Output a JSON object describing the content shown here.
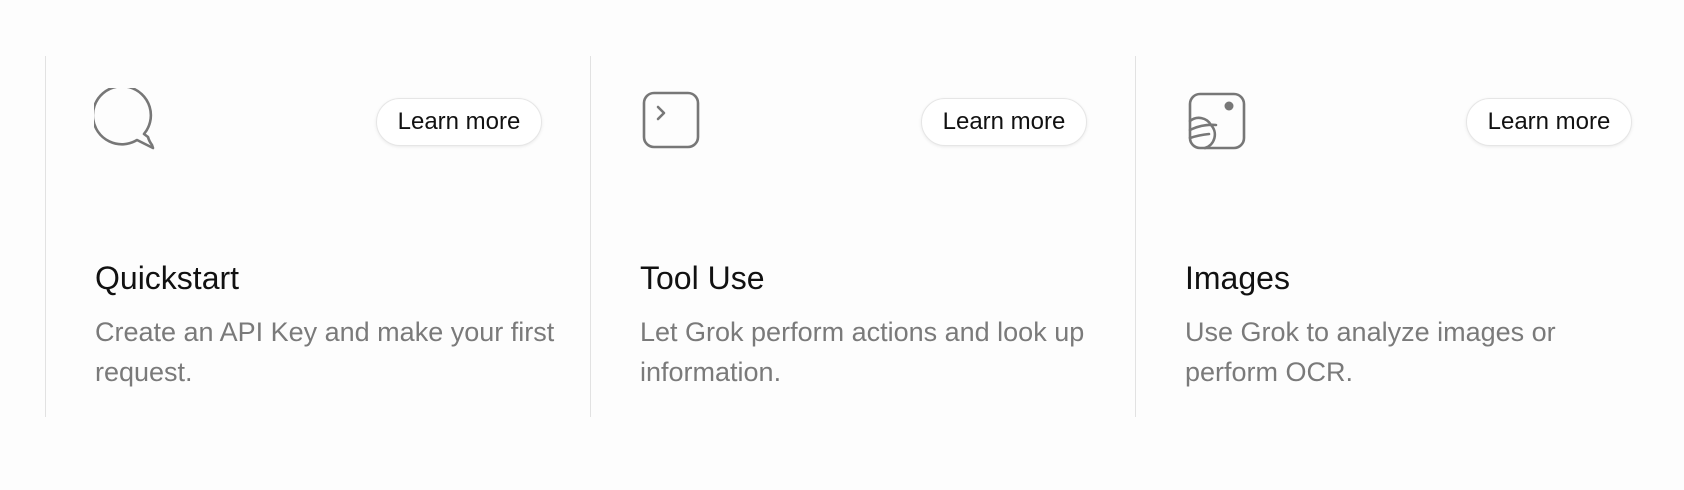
{
  "cards": [
    {
      "icon": "chat-bubble-icon",
      "button_label": "Learn more",
      "title": "Quickstart",
      "description": "Create an API Key and make your first request."
    },
    {
      "icon": "terminal-prompt-icon",
      "button_label": "Learn more",
      "title": "Tool Use",
      "description": "Let Grok perform actions and look up information."
    },
    {
      "icon": "image-planet-icon",
      "button_label": "Learn more",
      "title": "Images",
      "description": "Use Grok to analyze images or perform OCR."
    }
  ],
  "colors": {
    "background": "#fdfdfd",
    "divider": "#e2e2e2",
    "icon_stroke": "#777777",
    "title": "#111111",
    "description": "#7a7a7a"
  }
}
